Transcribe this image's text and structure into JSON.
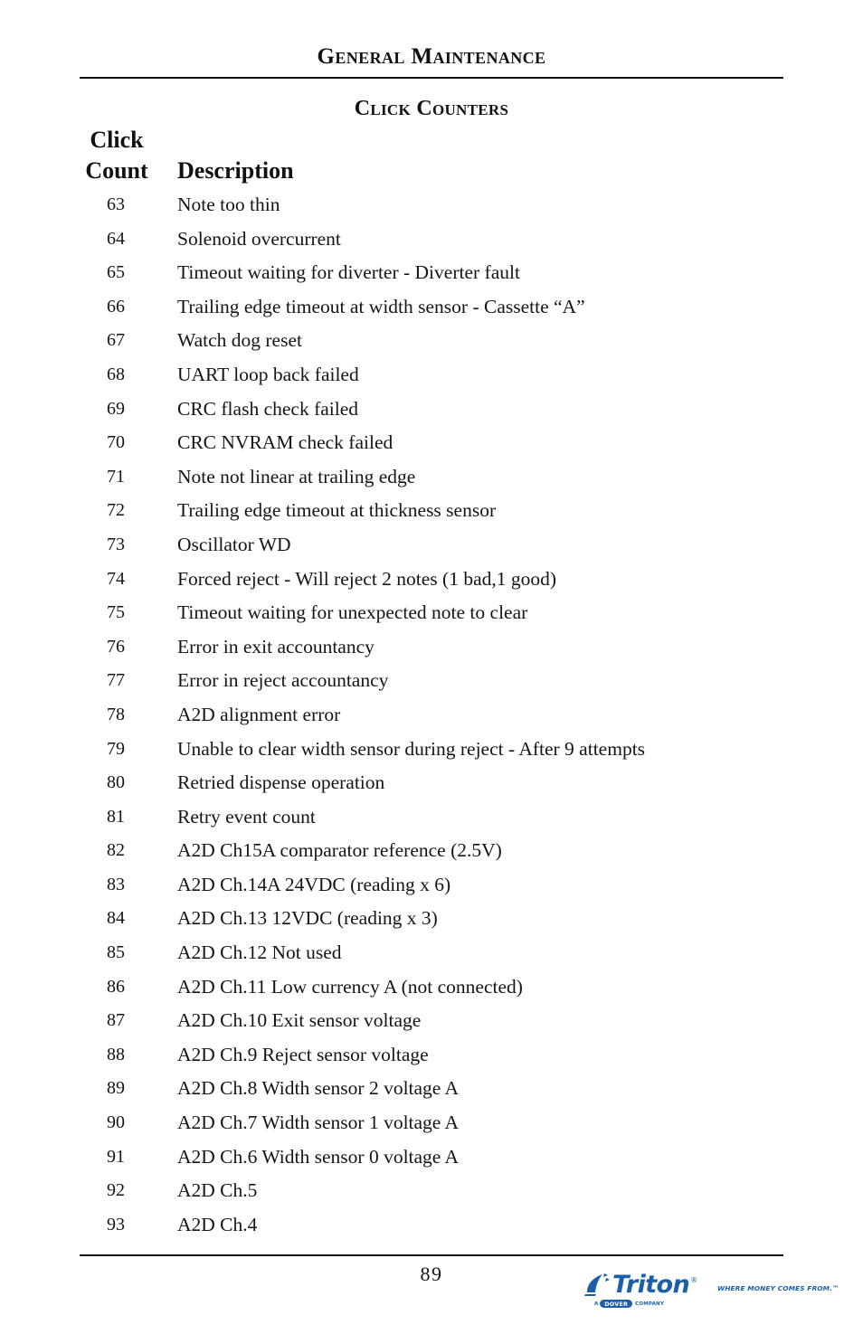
{
  "header": {
    "running_title": "General Maintenance"
  },
  "section": {
    "title": "Click Counters"
  },
  "table": {
    "headers": {
      "count_line1": "Click",
      "count_line2": "Count",
      "description": "Description"
    },
    "rows": [
      {
        "count": "63",
        "description": "Note too thin"
      },
      {
        "count": "64",
        "description": "Solenoid overcurrent"
      },
      {
        "count": "65",
        "description": "Timeout waiting for diverter - Diverter fault"
      },
      {
        "count": "66",
        "description": "Trailing edge timeout at width sensor - Cassette “A”"
      },
      {
        "count": "67",
        "description": "Watch dog reset"
      },
      {
        "count": "68",
        "description": "UART loop back failed"
      },
      {
        "count": "69",
        "description": "CRC flash check failed"
      },
      {
        "count": "70",
        "description": "CRC NVRAM check failed"
      },
      {
        "count": "71",
        "description": "Note not linear at trailing edge"
      },
      {
        "count": "72",
        "description": "Trailing edge timeout at thickness sensor"
      },
      {
        "count": "73",
        "description": "Oscillator WD"
      },
      {
        "count": "74",
        "description": "Forced reject - Will reject 2 notes (1 bad,1 good)"
      },
      {
        "count": "75",
        "description": "Timeout waiting for unexpected note to clear"
      },
      {
        "count": "76",
        "description": "Error in exit accountancy"
      },
      {
        "count": "77",
        "description": "Error in reject accountancy"
      },
      {
        "count": "78",
        "description": "A2D alignment error"
      },
      {
        "count": "79",
        "description": "Unable to clear width sensor during reject - After 9 attempts"
      },
      {
        "count": "80",
        "description": "Retried dispense operation"
      },
      {
        "count": "81",
        "description": "Retry event count"
      },
      {
        "count": "82",
        "description": "A2D Ch15A comparator reference (2.5V)"
      },
      {
        "count": "83",
        "description": "A2D Ch.14A 24VDC (reading x 6)"
      },
      {
        "count": "84",
        "description": "A2D Ch.13 12VDC (reading x 3)"
      },
      {
        "count": "85",
        "description": "A2D Ch.12 Not used"
      },
      {
        "count": "86",
        "description": "A2D Ch.11 Low currency A  (not connected)"
      },
      {
        "count": "87",
        "description": "A2D Ch.10 Exit sensor voltage"
      },
      {
        "count": "88",
        "description": "A2D Ch.9 Reject sensor voltage"
      },
      {
        "count": "89",
        "description": "A2D Ch.8 Width sensor 2 voltage A"
      },
      {
        "count": "90",
        "description": "A2D Ch.7 Width sensor 1 voltage A"
      },
      {
        "count": "91",
        "description": "A2D Ch.6 Width sensor 0 voltage A"
      },
      {
        "count": "92",
        "description": "A2D Ch.5"
      },
      {
        "count": "93",
        "description": "A2D Ch.4"
      }
    ]
  },
  "footer": {
    "page_number": "89",
    "logo": {
      "wordmark": "Triton",
      "registered_mark": "®",
      "tagline": "WHERE MONEY COMES FROM.™",
      "dover_prefix": "A",
      "dover_badge": "DOVER",
      "dover_suffix": "COMPANY",
      "color": "#1a5fa8"
    }
  }
}
